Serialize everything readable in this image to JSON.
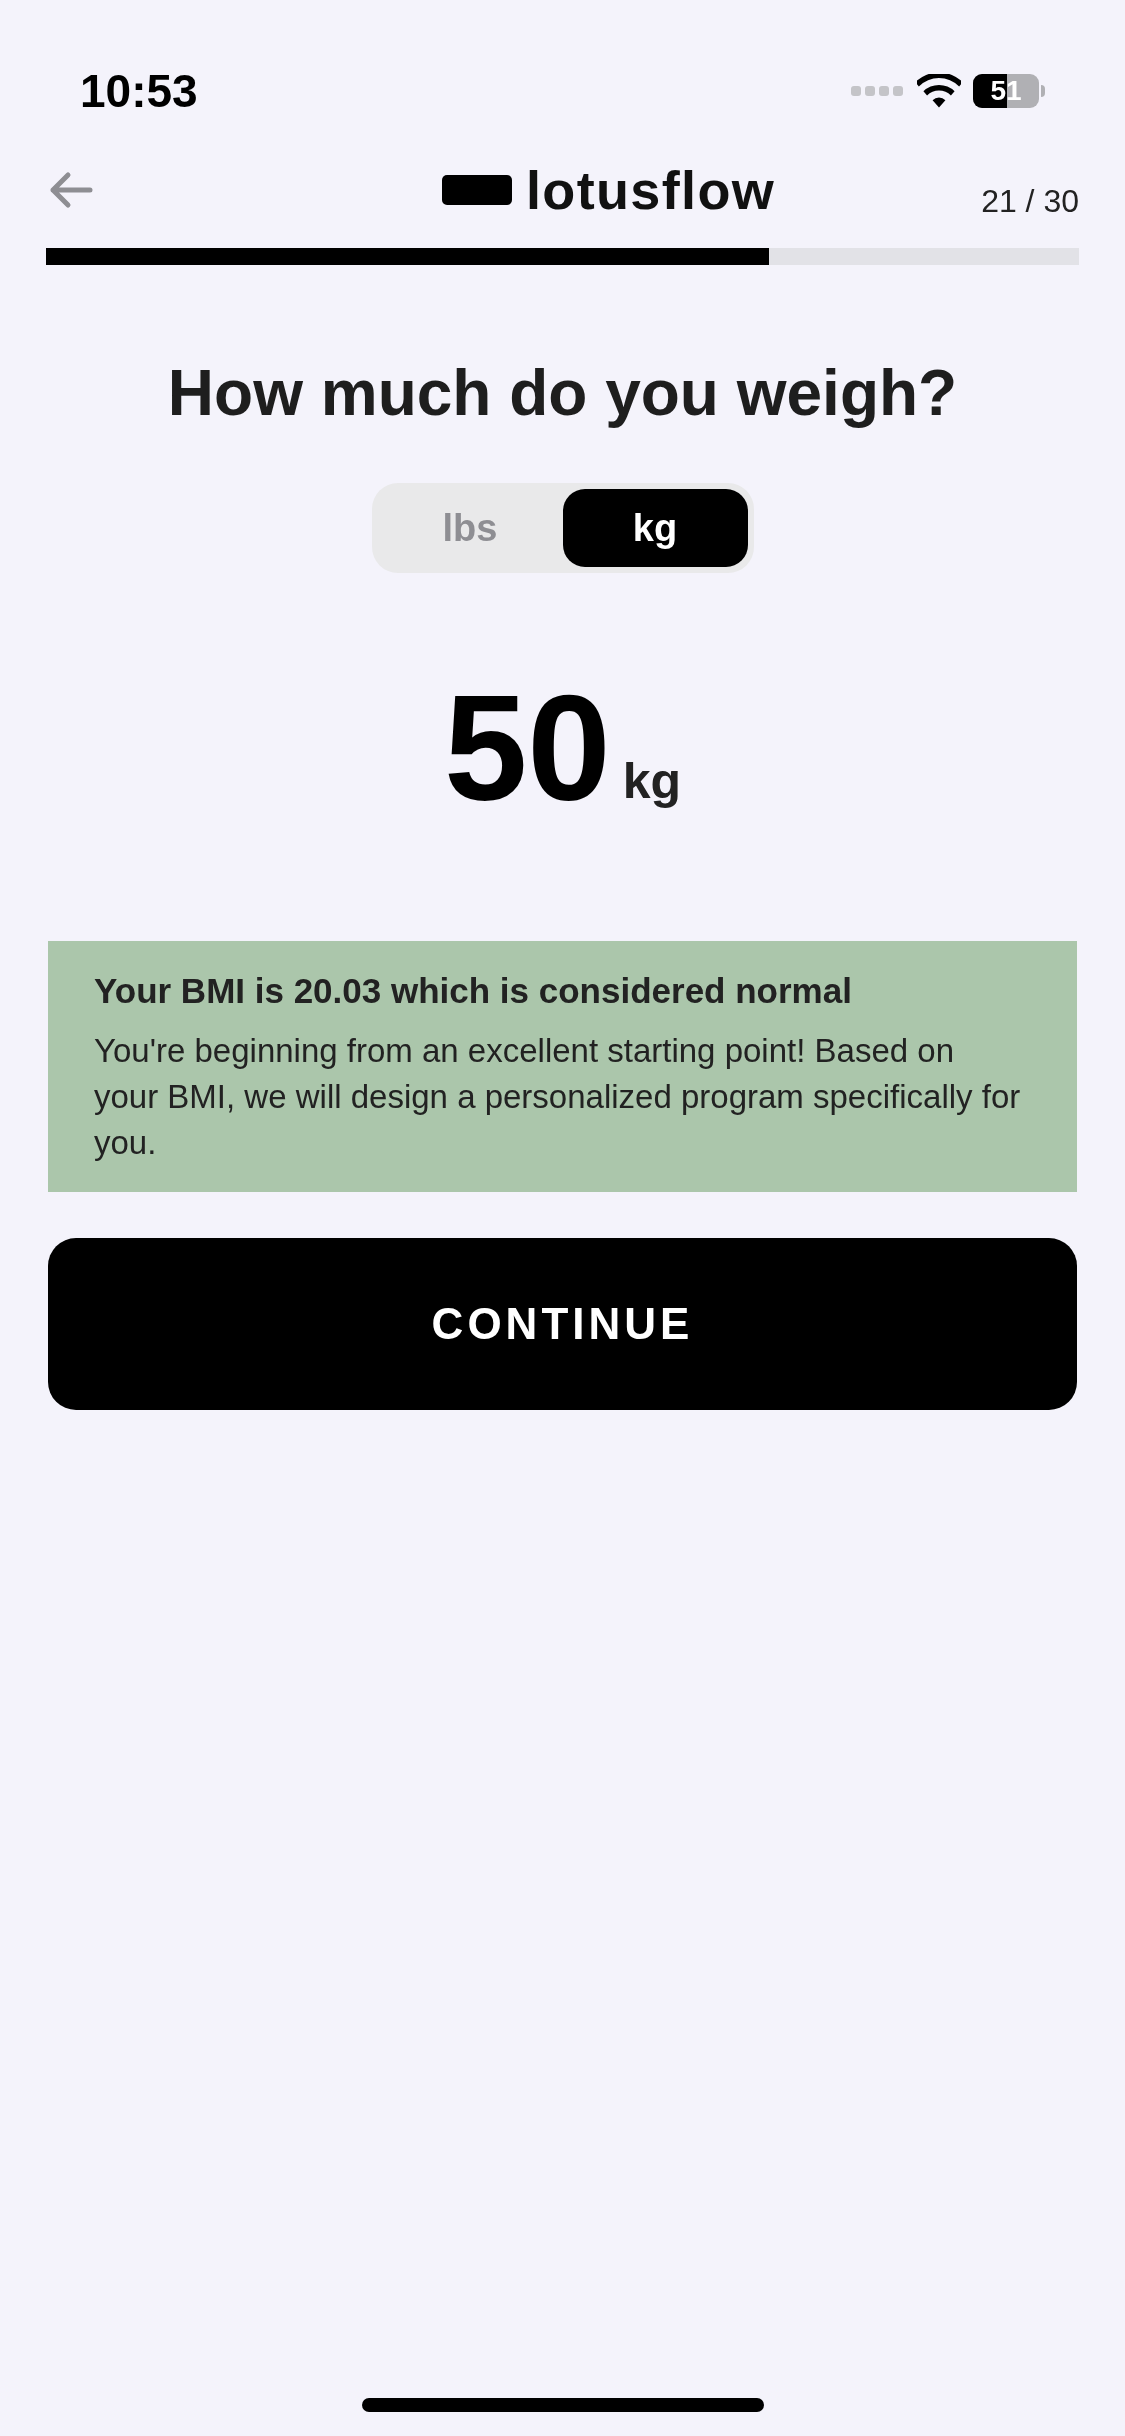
{
  "status_bar": {
    "time": "10:53",
    "battery": "51"
  },
  "header": {
    "brand": "lotusflow",
    "step": "21 / 30",
    "progress": {
      "level": 0.7
    }
  },
  "title": "How much do you weigh?",
  "units": [
    {
      "label": "lbs",
      "selected": false
    },
    {
      "label": "kg",
      "selected": true
    }
  ],
  "weight": {
    "value": "50",
    "unit": "kg"
  },
  "bmi_card": {
    "heading": "Your BMI is 20.03 which is considered normal",
    "text": "You're beginning from an excellent starting point! Based on your BMI, we will design a personalized program specifically for you."
  },
  "continue_button": "CONTINUE"
}
